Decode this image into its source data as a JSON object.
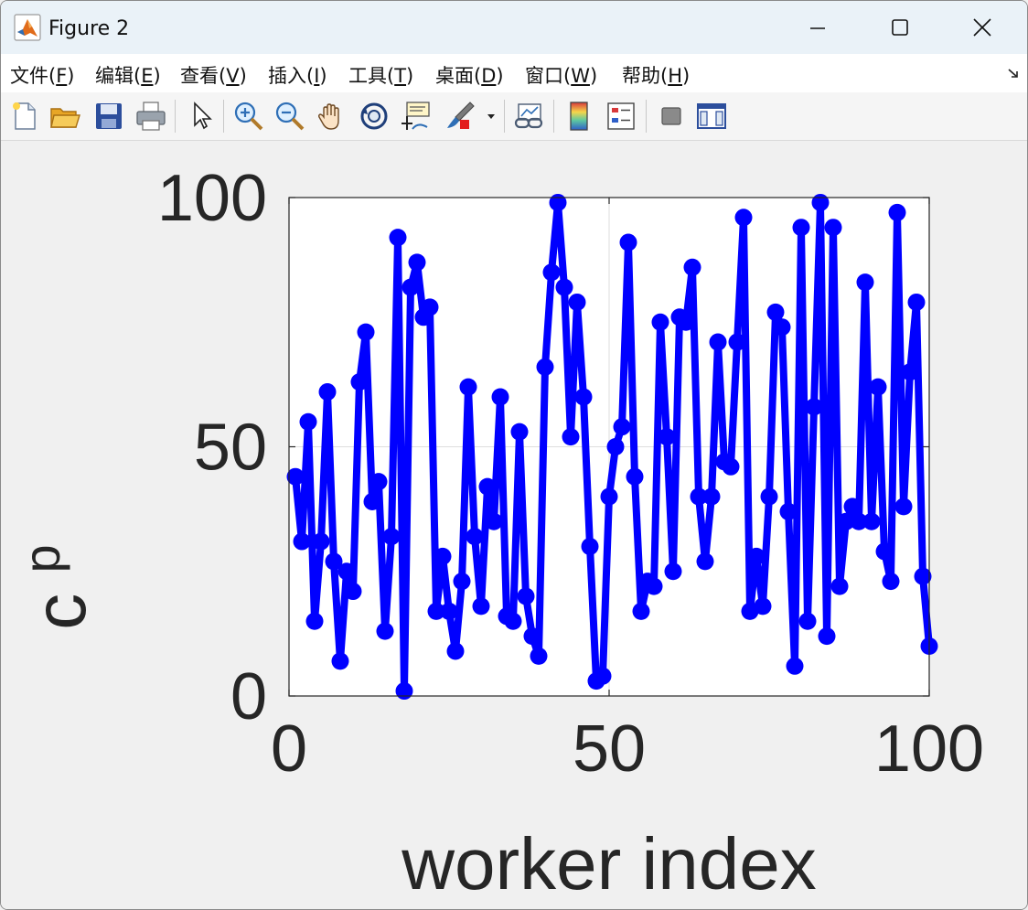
{
  "window": {
    "title": "Figure 2",
    "controls": [
      "minimize-icon",
      "maximize-icon",
      "close-icon"
    ]
  },
  "menu": {
    "items": [
      "文件(F)",
      "编辑(E)",
      "查看(V)",
      "插入(I)",
      "工具(T)",
      "桌面(D)",
      "窗口(W)",
      "帮助(H)"
    ],
    "mnemonics": [
      "F",
      "E",
      "V",
      "I",
      "T",
      "D",
      "W",
      "H"
    ]
  },
  "toolbar": {
    "buttons": [
      "new-figure-icon",
      "open-file-icon",
      "save-icon",
      "print-icon",
      "select-arrow-icon",
      "zoom-in-icon",
      "zoom-out-icon",
      "pan-hand-icon",
      "rotate-3d-icon",
      "data-cursor-icon",
      "brush-icon",
      "brush-dropdown-icon",
      "link-plot-icon",
      "colorbar-icon",
      "legend-icon",
      "hide-plot-tools-icon",
      "show-plot-tools-icon"
    ]
  },
  "colors": {
    "series": "#0000ff",
    "axes_text": "#262626",
    "figure_background": "#f0f0f0",
    "axes_background": "#ffffff",
    "grid": "#dedede"
  },
  "chart_data": {
    "type": "line",
    "xlabel": "worker index",
    "ylabel": "c",
    "ylabel_subscript": "p",
    "xlim": [
      0,
      100
    ],
    "ylim": [
      0,
      100
    ],
    "xticks": [
      0,
      50,
      100
    ],
    "yticks": [
      0,
      50,
      100
    ],
    "xtick_labels": [
      "0",
      "50",
      "100"
    ],
    "ytick_labels": [
      "0",
      "50",
      "100"
    ],
    "grid": true,
    "markers": "filled-circle",
    "series": [
      {
        "x": [
          1,
          2,
          3,
          4,
          5,
          6,
          7,
          8,
          9,
          10,
          11,
          12,
          13,
          14,
          15,
          16,
          17,
          18,
          19,
          20,
          21,
          22,
          23,
          24,
          25,
          26,
          27,
          28,
          29,
          30,
          31,
          32,
          33,
          34,
          35,
          36,
          37,
          38,
          39,
          40,
          41,
          42,
          43,
          44,
          45,
          46,
          47,
          48,
          49,
          50,
          51,
          52,
          53,
          54,
          55,
          56,
          57,
          58,
          59,
          60,
          61,
          62,
          63,
          64,
          65,
          66,
          67,
          68,
          69,
          70,
          71,
          72,
          73,
          74,
          75,
          76,
          77,
          78,
          79,
          80,
          81,
          82,
          83,
          84,
          85,
          86,
          87,
          88,
          89,
          90,
          91,
          92,
          93,
          94,
          95,
          96,
          97,
          98,
          99,
          100
        ],
        "values": [
          44,
          31,
          55,
          15,
          31,
          61,
          27,
          7,
          25,
          21,
          63,
          73,
          39,
          43,
          13,
          32,
          92,
          1,
          82,
          87,
          76,
          78,
          17,
          28,
          17,
          9,
          23,
          62,
          32,
          18,
          42,
          35,
          60,
          16,
          15,
          53,
          20,
          12,
          8,
          66,
          85,
          99,
          82,
          52,
          79,
          60,
          30,
          3,
          4,
          40,
          50,
          54,
          91,
          44,
          17,
          23,
          22,
          75,
          52,
          25,
          76,
          75,
          86,
          40,
          27,
          40,
          71,
          47,
          46,
          71,
          96,
          17,
          28,
          18,
          40,
          77,
          74,
          37,
          6,
          94,
          15,
          58,
          99,
          12,
          94,
          22,
          35,
          38,
          35,
          83,
          35,
          62,
          29,
          23,
          97,
          38,
          65,
          79,
          24,
          10
        ]
      }
    ]
  }
}
